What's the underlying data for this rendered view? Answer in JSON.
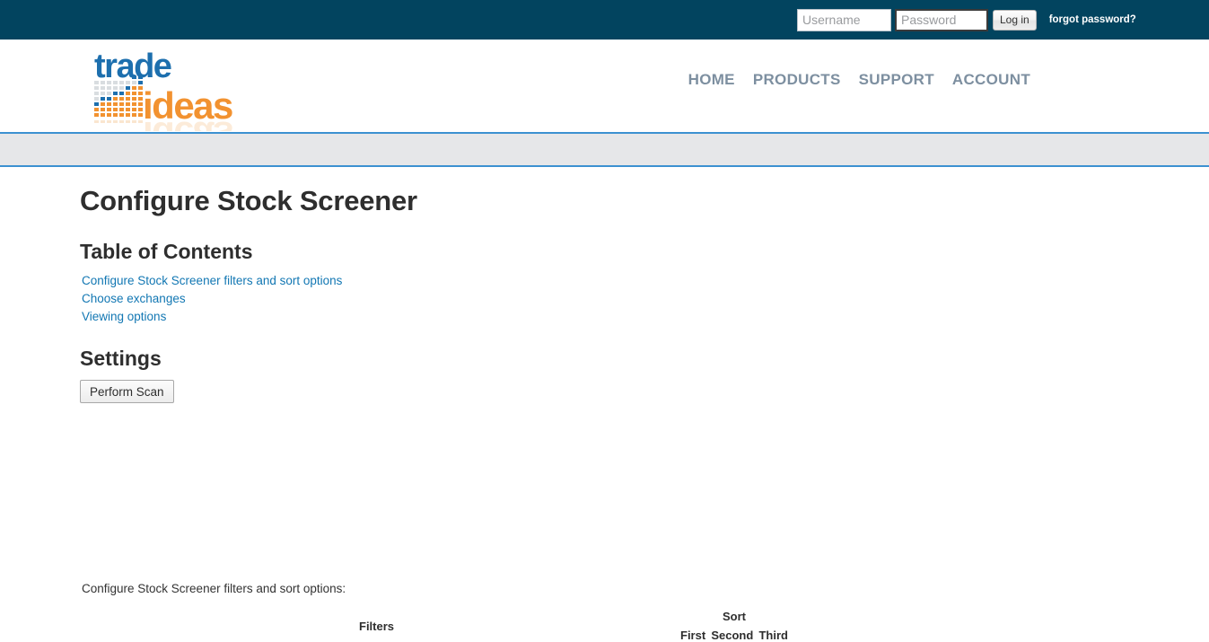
{
  "topbar": {
    "username_placeholder": "Username",
    "username_value": "",
    "password_placeholder": "Password",
    "password_value": "",
    "login_label": "Log in",
    "forgot_label": "forgot password?",
    "background_color": "#02445f"
  },
  "header": {
    "logo": {
      "word_top": "trade",
      "word_bottom": "ideas",
      "blue": "#1d6fae",
      "orange": "#f29230"
    },
    "nav": [
      {
        "label": "HOME"
      },
      {
        "label": "PRODUCTS"
      },
      {
        "label": "SUPPORT"
      },
      {
        "label": "ACCOUNT"
      }
    ],
    "nav_color": "#7d8fa0"
  },
  "graybar": {
    "background_color": "#e6e7e9",
    "border_color": "#3c91d1"
  },
  "main": {
    "page_title": "Configure Stock Screener",
    "toc_title": "Table of Contents",
    "toc_links": [
      {
        "label": "Configure Stock Screener filters and sort options"
      },
      {
        "label": "Choose exchanges"
      },
      {
        "label": "Viewing options"
      }
    ],
    "link_color": "#1277b3",
    "settings_title": "Settings",
    "perform_scan_label": "Perform Scan",
    "section_label": "Configure Stock Screener filters and sort options:"
  },
  "config_table": {
    "filters_header": "Filters",
    "sort_header": "Sort",
    "sort_columns": [
      "First",
      "Second",
      "Third"
    ]
  }
}
